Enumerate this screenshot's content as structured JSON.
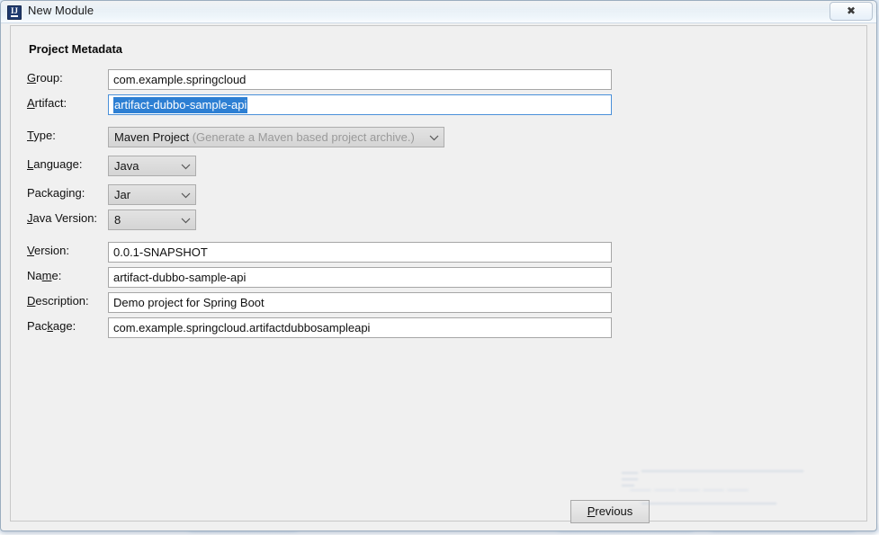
{
  "window": {
    "title": "New Module",
    "app_icon": "intellij-idea-icon",
    "close_label": "✖"
  },
  "section": {
    "title": "Project Metadata"
  },
  "form": {
    "fields": [
      {
        "name": "group",
        "label_pre": "",
        "label_mnemonic": "G",
        "label_post": "roup:",
        "value": "com.example.springcloud",
        "type": "text"
      },
      {
        "name": "artifact",
        "label_pre": "",
        "label_mnemonic": "A",
        "label_post": "rtifact:",
        "value": "artifact-dubbo-sample-api",
        "type": "text-selected"
      },
      {
        "name": "type",
        "label_pre": "",
        "label_mnemonic": "T",
        "label_post": "ype:",
        "value": "Maven Project",
        "hint": "(Generate a Maven based project archive.)",
        "type": "combo"
      },
      {
        "name": "language",
        "label_pre": "",
        "label_mnemonic": "L",
        "label_post": "anguage:",
        "value": "Java",
        "type": "combo"
      },
      {
        "name": "packaging",
        "label_pre": "Packa",
        "label_mnemonic": "g",
        "label_post": "ing:",
        "value": "Jar",
        "type": "combo"
      },
      {
        "name": "java-version",
        "label_pre": "",
        "label_mnemonic": "J",
        "label_post": "ava Version:",
        "value": "8",
        "type": "combo"
      },
      {
        "name": "version",
        "label_pre": "",
        "label_mnemonic": "V",
        "label_post": "ersion:",
        "value": "0.0.1-SNAPSHOT",
        "type": "text"
      },
      {
        "name": "name",
        "label_pre": "Na",
        "label_mnemonic": "m",
        "label_post": "e:",
        "value": "artifact-dubbo-sample-api",
        "type": "text"
      },
      {
        "name": "description",
        "label_pre": "",
        "label_mnemonic": "D",
        "label_post": "escription:",
        "value": "Demo project for Spring Boot",
        "type": "text"
      },
      {
        "name": "package",
        "label_pre": "Pac",
        "label_mnemonic": "k",
        "label_post": "age:",
        "value": "com.example.springcloud.artifactdubbosampleapi",
        "type": "text"
      }
    ]
  },
  "buttons": {
    "previous_pre": "",
    "previous_mnemonic": "P",
    "previous_post": "revious"
  },
  "colors": {
    "selection_blue": "#2d7fd3",
    "focus_border": "#4a90d9",
    "panel_bg": "#f0f0f0",
    "combo_bg": "#dcdcdc",
    "hint_gray": "#9a9a9a"
  }
}
